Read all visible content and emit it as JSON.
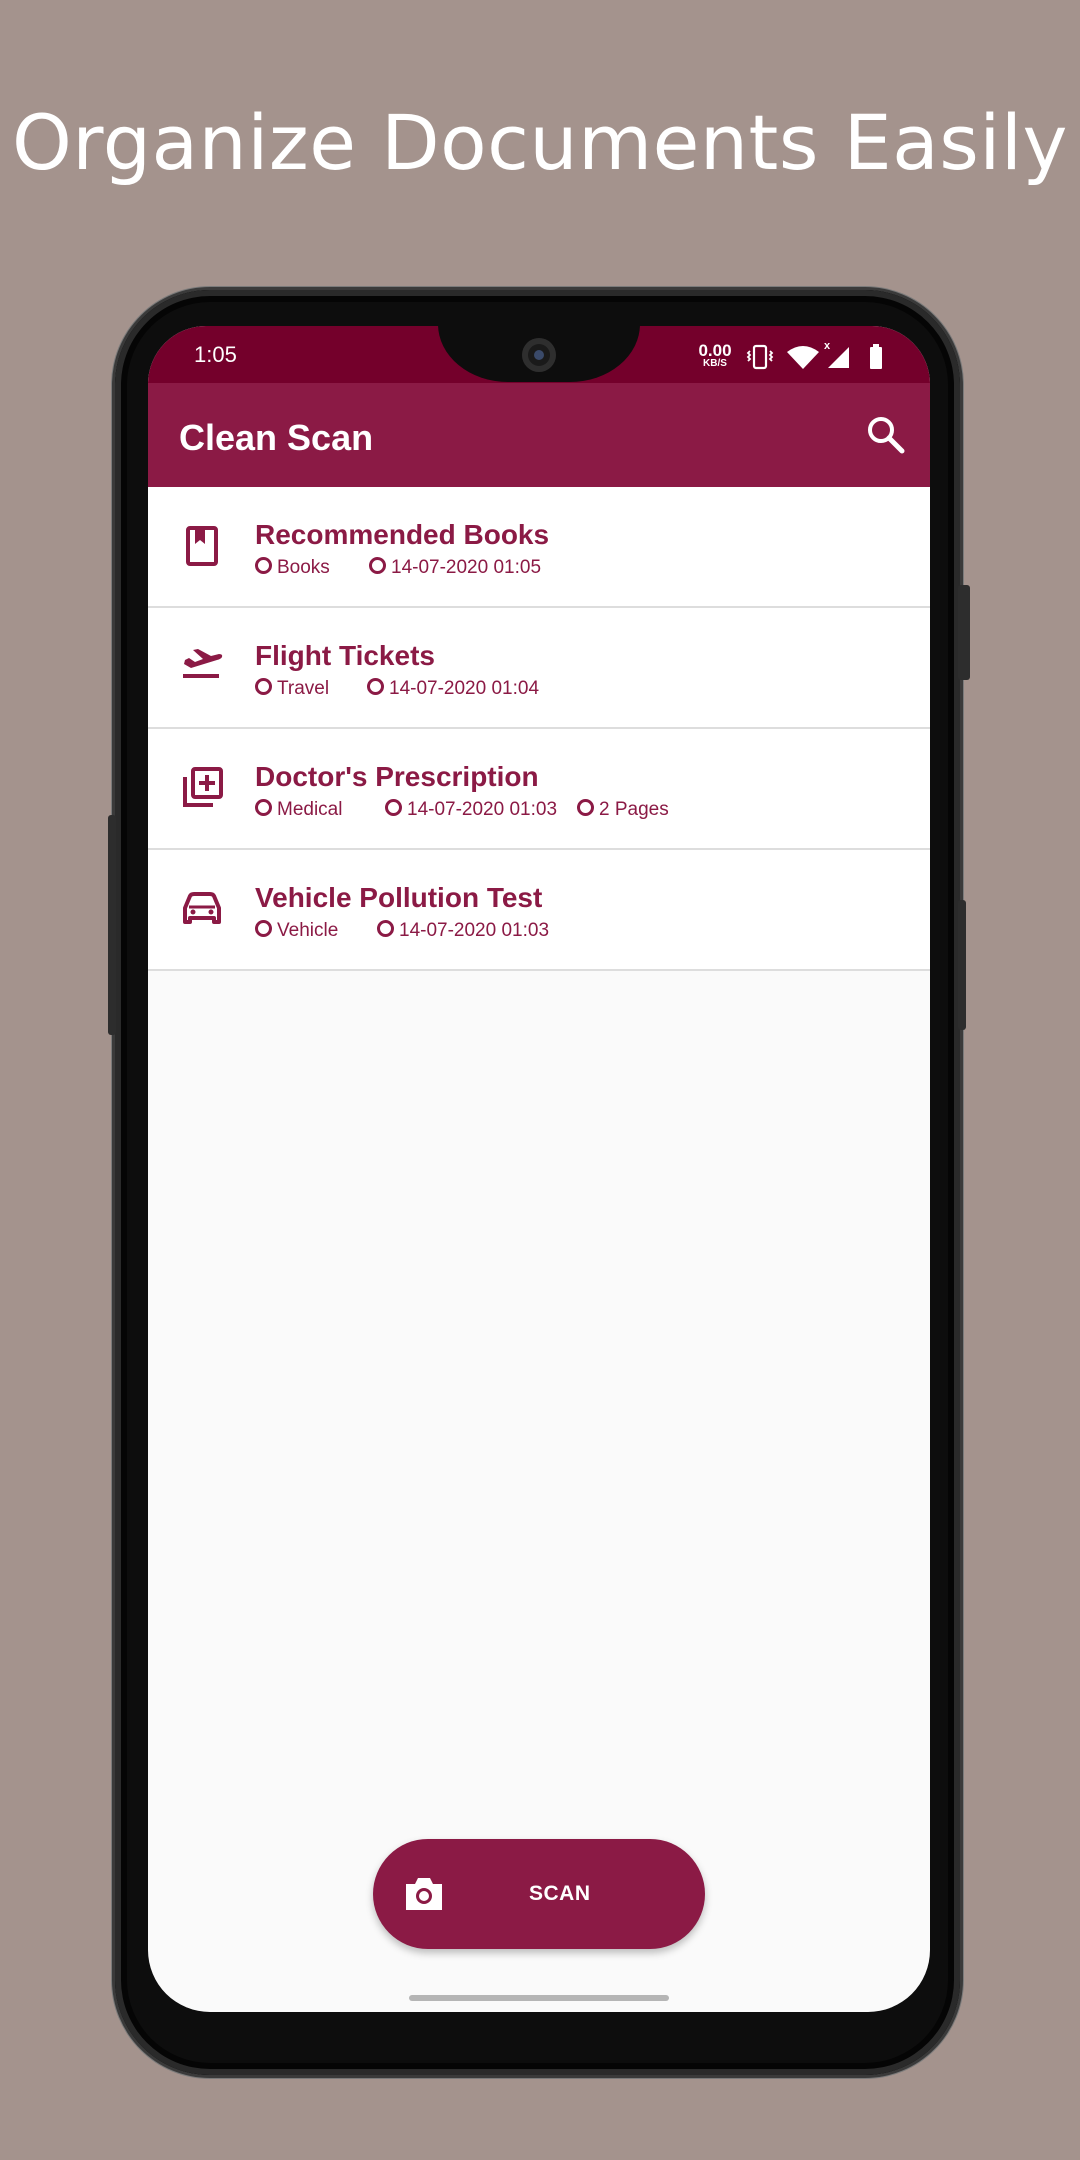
{
  "headline": "Organize Documents Easily",
  "status_bar": {
    "time": "1:05",
    "net_speed_value": "0.00",
    "net_speed_unit": "KB/S",
    "icons": [
      "vibrate-icon",
      "wifi-icon",
      "signal-icon",
      "battery-icon"
    ]
  },
  "app_bar": {
    "title": "Clean Scan",
    "search_icon": "search-icon"
  },
  "documents": [
    {
      "title": "Recommended Books",
      "icon": "bookmark-book-icon",
      "category": "Books",
      "datetime": "14-07-2020 01:05",
      "pages": ""
    },
    {
      "title": "Flight Tickets",
      "icon": "flight-takeoff-icon",
      "category": "Travel",
      "datetime": "14-07-2020 01:04",
      "pages": ""
    },
    {
      "title": "Doctor's Prescription",
      "icon": "medical-add-icon",
      "category": "Medical",
      "datetime": "14-07-2020 01:03",
      "pages": "2 Pages"
    },
    {
      "title": "Vehicle Pollution Test",
      "icon": "car-icon",
      "category": "Vehicle",
      "datetime": "14-07-2020 01:03",
      "pages": ""
    }
  ],
  "scan_button": {
    "label": "SCAN",
    "icon": "camera-icon"
  },
  "colors": {
    "background": "#a4938d",
    "status_bar": "#74002b",
    "primary": "#8b1a45",
    "list_bg": "#ffffff",
    "screen_bg": "#fafafa"
  }
}
